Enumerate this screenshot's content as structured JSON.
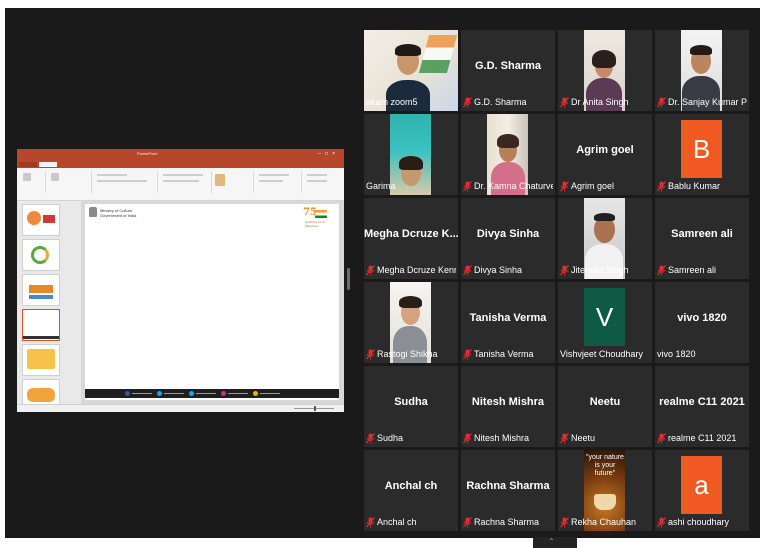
{
  "shared_screen": {
    "app_title": "PowerPoint",
    "slide": {
      "org_line1": "Ministry of Culture",
      "org_line2": "Government of India",
      "badge_number": "75",
      "badge_text": "Azadi Ka Amrit Mahotsav"
    }
  },
  "participants": [
    {
      "name": "akam zoom5",
      "display": "video",
      "active": true,
      "muted": false
    },
    {
      "name": "G.D. Sharma",
      "display": "name",
      "muted": true
    },
    {
      "name": "Dr Anita Singh",
      "display": "video",
      "muted": true
    },
    {
      "name": "Dr. Sanjay Kumar Prin...",
      "display": "video",
      "muted": true
    },
    {
      "name": "Garima",
      "display": "video",
      "muted": false
    },
    {
      "name": "Dr. Kamna Chaturvedi",
      "display": "video",
      "muted": true
    },
    {
      "name": "Agrim goel",
      "display": "name",
      "muted": true
    },
    {
      "name": "Bablu Kumar",
      "display": "avatar",
      "avatar_letter": "B",
      "avatar_color": "#f05a22",
      "muted": true
    },
    {
      "name": "Megha Dcruze K...",
      "label": "Megha Dcruze Kenne...",
      "display": "name",
      "muted": true
    },
    {
      "name": "Divya Sinha",
      "display": "name",
      "muted": true
    },
    {
      "name": "Jitendra Singh",
      "display": "video",
      "muted": true
    },
    {
      "name": "Samreen ali",
      "display": "name",
      "muted": true
    },
    {
      "name": "Rastogi Shikha",
      "display": "video",
      "muted": true
    },
    {
      "name": "Tanisha Verma",
      "display": "name",
      "muted": true
    },
    {
      "name": "Vishvjeet Choudhary",
      "display": "avatar",
      "avatar_letter": "V",
      "avatar_color": "#0f5a45",
      "muted": false
    },
    {
      "name": "vivo 1820",
      "display": "name",
      "muted": false
    },
    {
      "name": "Sudha",
      "display": "name",
      "muted": true
    },
    {
      "name": "Nitesh Mishra",
      "display": "name",
      "muted": true
    },
    {
      "name": "Neetu",
      "display": "name",
      "muted": true
    },
    {
      "name": "realme C11 2021",
      "display": "name",
      "muted": true
    },
    {
      "name": "Anchal ch",
      "display": "name",
      "muted": true
    },
    {
      "name": "Rachna Sharma",
      "display": "name",
      "muted": true
    },
    {
      "name": "Rekha Chauhan",
      "display": "image",
      "image_text": "\"your nature is your future\"",
      "muted": true
    },
    {
      "name": "ashi choudhary",
      "display": "avatar",
      "avatar_letter": "a",
      "avatar_color": "#f05a22",
      "muted": true
    }
  ],
  "colors": {
    "active_speaker_border": "#d9dd5b",
    "muted_icon": "#e02d2d",
    "tile_bg": "#2b2b2b"
  }
}
